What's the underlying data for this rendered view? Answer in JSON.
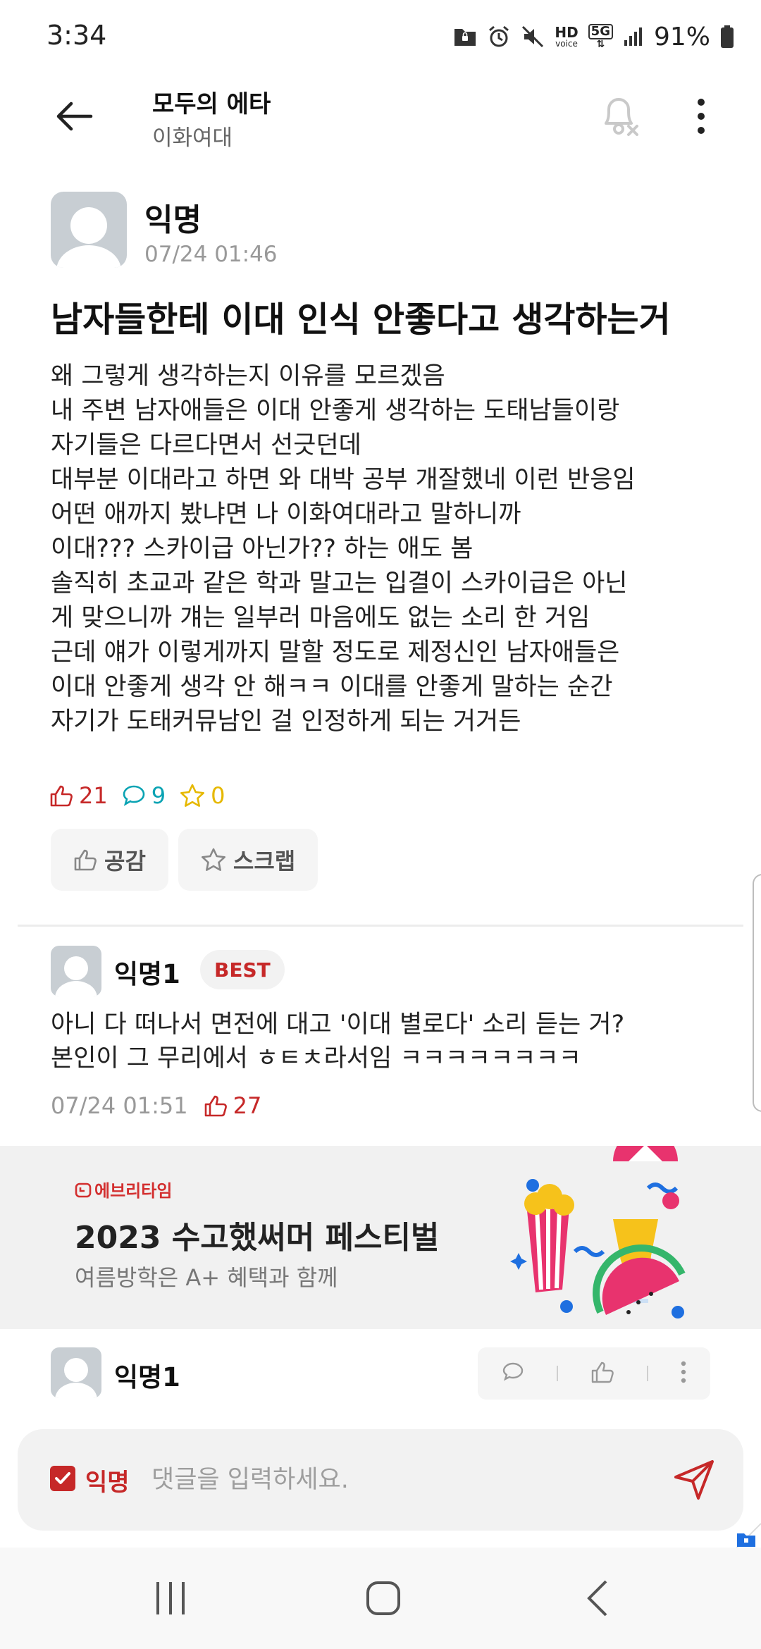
{
  "status_bar": {
    "time": "3:34",
    "battery": "91%",
    "hd_label": "HD",
    "voice_label": "voice",
    "network": "5G"
  },
  "header": {
    "board_title": "모두의 에타",
    "board_subtitle": "이화여대"
  },
  "post": {
    "author": "익명",
    "date": "07/24 01:46",
    "title": "남자들한테 이대 인식 안좋다고 생각하는거",
    "body": "왜 그렇게 생각하는지 이유를 모르겠음\n내 주변 남자애들은 이대 안좋게 생각하는 도태남들이랑\n자기들은 다르다면서 선긋던데\n대부분 이대라고 하면 와 대박 공부 개잘했네 이런 반응임\n어떤 애까지 봤냐면 나 이화여대라고 말하니까\n이대??? 스카이급 아닌가?? 하는 애도 봄\n솔직히 초교과 같은 학과 말고는 입결이 스카이급은 아닌\n게 맞으니까 걔는 일부러 마음에도 없는 소리 한 거임\n근데 얘가 이렇게까지 말할 정도로 제정신인 남자애들은\n이대 안좋게 생각 안 해ㅋㅋ 이대를 안좋게 말하는 순간\n자기가 도태커뮤남인 걸 인정하게 되는 거거든",
    "likes": "21",
    "comments": "9",
    "scraps": "0",
    "like_button_label": "공감",
    "scrap_button_label": "스크랩"
  },
  "comments": [
    {
      "author": "익명1",
      "badge": "BEST",
      "body": "아니 다 떠나서 면전에 대고 '이대 별로다' 소리 듣는 거?\n본인이 그 무리에서 ㅎㅌㅊ라서임 ㅋㅋㅋㅋㅋㅋㅋㅋ",
      "date": "07/24 01:51",
      "likes": "27"
    },
    {
      "author": "익명1"
    }
  ],
  "banner": {
    "brand": "에브리타임",
    "title": "2023 수고했써머 페스티벌",
    "subtitle": "여름방학은 A+ 혜택과 함께"
  },
  "comment_input": {
    "anonymous_label": "익명",
    "anonymous_checked": true,
    "placeholder": "댓글을 입력하세요."
  },
  "colors": {
    "accent": "#c62828",
    "comment_stat": "#0aa3b3",
    "scrap_stat": "#e6b800",
    "muted": "#999999"
  },
  "icons": {
    "back": "arrow-left-icon",
    "notify": "bell-off-icon",
    "more": "more-vertical-icon",
    "like": "thumbs-up-icon",
    "comment": "speech-bubble-icon",
    "scrap": "star-icon",
    "send": "paper-plane-icon"
  }
}
